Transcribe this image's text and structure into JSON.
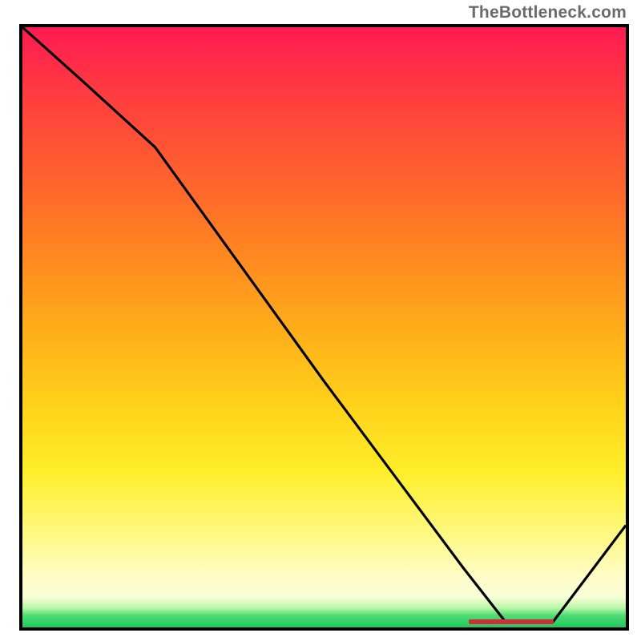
{
  "watermark": "TheBottleneck.com",
  "colors": {
    "curve": "#000000",
    "optimum": "#d42b3a",
    "border": "#000000"
  },
  "chart_data": {
    "type": "line",
    "title": "",
    "xlabel": "",
    "ylabel": "",
    "xlim": [
      0,
      100
    ],
    "ylim": [
      0,
      100
    ],
    "grid": false,
    "series": [
      {
        "name": "bottleneck-curve",
        "x": [
          0,
          10,
          22,
          50,
          73,
          80,
          88,
          100
        ],
        "values": [
          100,
          91,
          80,
          41,
          10,
          1,
          1,
          17
        ]
      }
    ],
    "optimum_band": {
      "x_start": 74,
      "x_end": 88,
      "y": 1
    },
    "gradient_stops": [
      {
        "pct": 0,
        "color": "#ff1a52"
      },
      {
        "pct": 28,
        "color": "#ff6a2a"
      },
      {
        "pct": 63,
        "color": "#ffd21a"
      },
      {
        "pct": 92,
        "color": "#fffccb"
      },
      {
        "pct": 100,
        "color": "#1ec95c"
      }
    ]
  }
}
